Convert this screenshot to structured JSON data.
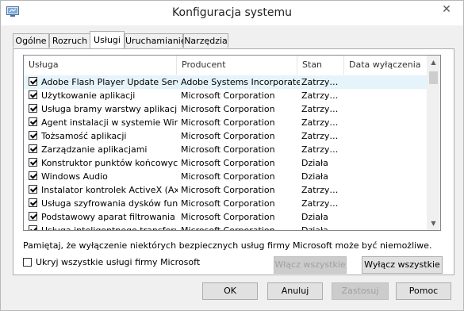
{
  "window": {
    "title": "Konfiguracja systemu",
    "close_glyph": "✕",
    "icon": "msconfig-icon"
  },
  "tabs": [
    {
      "label": "Ogólne"
    },
    {
      "label": "Rozruch"
    },
    {
      "label": "Usługi",
      "active": true
    },
    {
      "label": "Uruchamianie"
    },
    {
      "label": "Narzędzia"
    }
  ],
  "services": {
    "columns": [
      "Usługa",
      "Producent",
      "Stan",
      "Data wyłączenia"
    ],
    "rows": [
      {
        "name": "Adobe Flash Player Update Service",
        "vendor": "Adobe Systems Incorporated",
        "state": "Zatrzy…",
        "checked": true
      },
      {
        "name": "Użytkowanie aplikacji",
        "vendor": "Microsoft Corporation",
        "state": "Zatrzy…",
        "checked": true
      },
      {
        "name": "Usługa bramy warstwy aplikacji",
        "vendor": "Microsoft Corporation",
        "state": "Zatrzy…",
        "checked": true
      },
      {
        "name": "Agent instalacji w systemie Wind…",
        "vendor": "Microsoft Corporation",
        "state": "Zatrzy…",
        "checked": true
      },
      {
        "name": "Tożsamość aplikacji",
        "vendor": "Microsoft Corporation",
        "state": "Zatrzy…",
        "checked": true
      },
      {
        "name": "Zarządzanie aplikacjami",
        "vendor": "Microsoft Corporation",
        "state": "Zatrzy…",
        "checked": true
      },
      {
        "name": "Konstruktor punktów końcowych…",
        "vendor": "Microsoft Corporation",
        "state": "Działa",
        "checked": true
      },
      {
        "name": "Windows Audio",
        "vendor": "Microsoft Corporation",
        "state": "Działa",
        "checked": true
      },
      {
        "name": "Instalator kontrolek ActiveX (Ax…",
        "vendor": "Microsoft Corporation",
        "state": "Zatrzy…",
        "checked": true
      },
      {
        "name": "Usługa szyfrowania dysków fun…",
        "vendor": "Microsoft Corporation",
        "state": "Zatrzy…",
        "checked": true
      },
      {
        "name": "Podstawowy aparat filtrowania",
        "vendor": "Microsoft Corporation",
        "state": "Działa",
        "checked": true
      },
      {
        "name": "Usługa inteligentnego transferu…",
        "vendor": "Microsoft Corporation",
        "state": "Działa",
        "checked": true
      }
    ]
  },
  "note": "Pamiętaj, że wyłączenie niektórych bezpiecznych usług firmy Microsoft może być niemożliwe.",
  "hide_ms": {
    "label": "Ukryj wszystkie usługi firmy Microsoft",
    "checked": false
  },
  "buttons": {
    "enable_all": "Włącz wszystkie",
    "disable_all": "Wyłącz wszystkie",
    "ok": "OK",
    "cancel": "Anuluj",
    "apply": "Zastosuj",
    "help": "Pomoc"
  }
}
